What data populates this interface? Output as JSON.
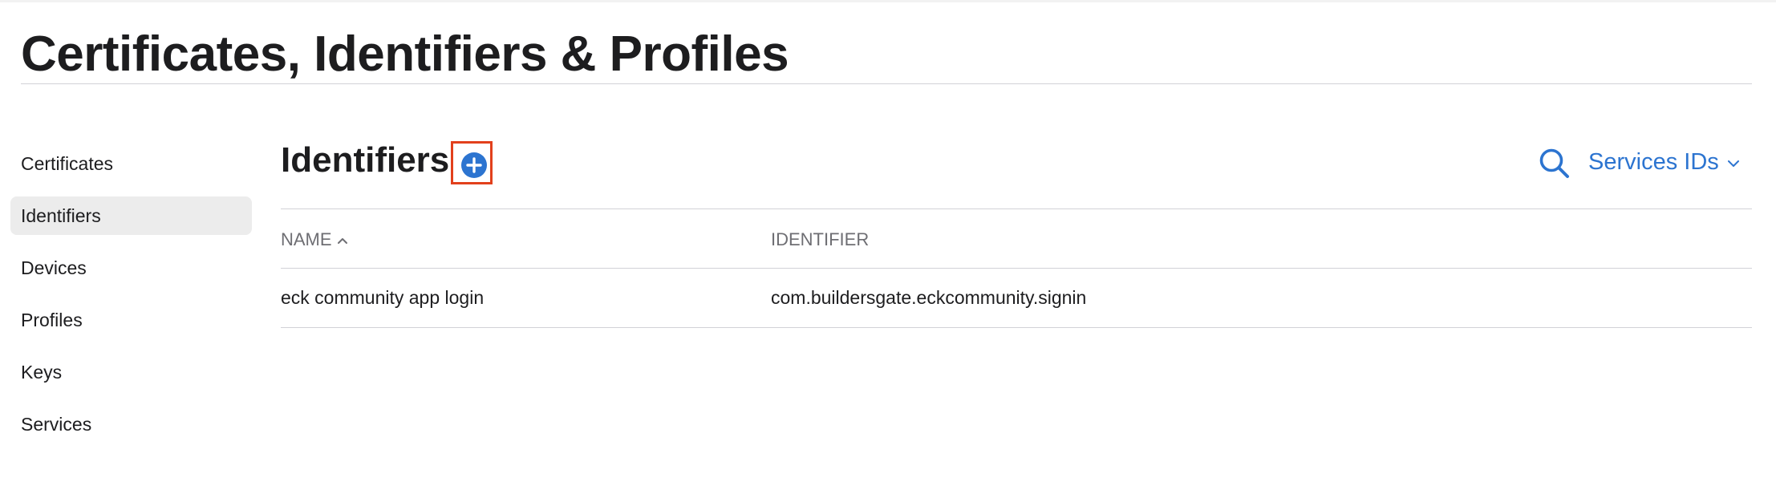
{
  "page": {
    "title": "Certificates, Identifiers & Profiles"
  },
  "sidebar": {
    "items": [
      {
        "label": "Certificates",
        "active": false
      },
      {
        "label": "Identifiers",
        "active": true
      },
      {
        "label": "Devices",
        "active": false
      },
      {
        "label": "Profiles",
        "active": false
      },
      {
        "label": "Keys",
        "active": false
      },
      {
        "label": "Services",
        "active": false
      }
    ]
  },
  "main": {
    "section_title": "Identifiers",
    "add_icon": "plus-circle-icon",
    "search_icon": "search-icon",
    "filter": {
      "selected": "Services IDs",
      "icon": "chevron-down-icon"
    },
    "table": {
      "columns": [
        {
          "label": "NAME",
          "sort": "ascending"
        },
        {
          "label": "IDENTIFIER"
        }
      ],
      "rows": [
        {
          "name": "eck community app login",
          "identifier": "com.buildersgate.eckcommunity.signin"
        }
      ]
    }
  },
  "colors": {
    "accent": "#2c74d0",
    "highlight_box": "#e2401c",
    "active_item_bg": "#ececec",
    "text": "#1d1d1f",
    "muted_text": "#6e6e73",
    "divider": "#d2d2d7"
  }
}
